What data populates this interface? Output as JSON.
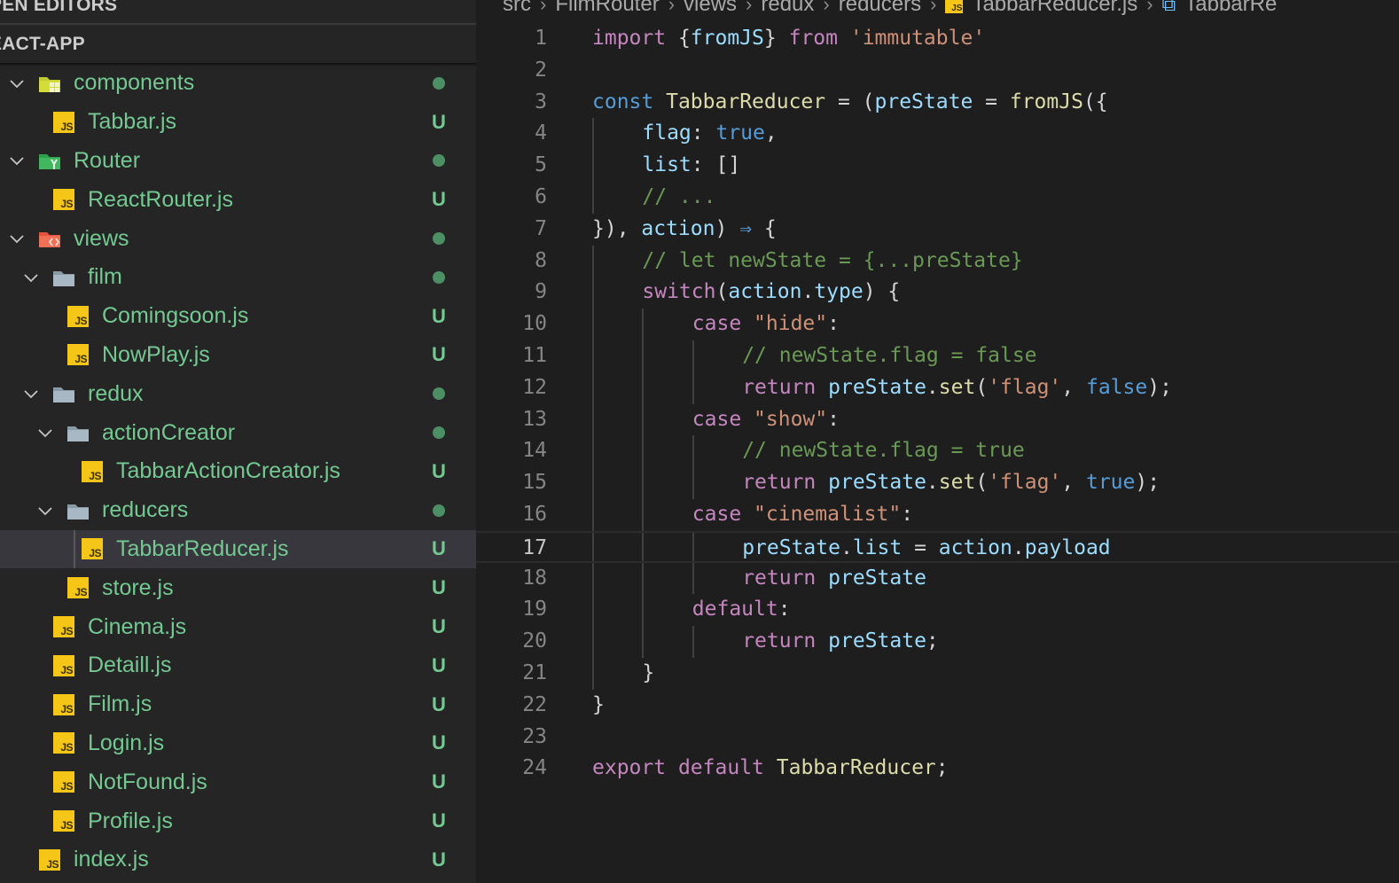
{
  "sidebar": {
    "open_editors_label": "PEN EDITORS",
    "project_label": "EACT-APP",
    "tree": [
      {
        "label": "components",
        "depth": 0,
        "kind": "folder",
        "icon": "components-folder-icon",
        "expanded": true,
        "status": "dot"
      },
      {
        "label": "Tabbar.js",
        "depth": 1,
        "kind": "js",
        "status": "U"
      },
      {
        "label": "Router",
        "depth": 0,
        "kind": "folder",
        "icon": "router-folder-icon",
        "expanded": true,
        "status": "dot"
      },
      {
        "label": "ReactRouter.js",
        "depth": 1,
        "kind": "js",
        "status": "U"
      },
      {
        "label": "views",
        "depth": 0,
        "kind": "folder",
        "icon": "views-folder-icon",
        "expanded": true,
        "status": "dot"
      },
      {
        "label": "film",
        "depth": 1,
        "kind": "folder",
        "icon": "folder-icon",
        "expanded": true,
        "status": "dot"
      },
      {
        "label": "Comingsoon.js",
        "depth": 2,
        "kind": "js",
        "status": "U"
      },
      {
        "label": "NowPlay.js",
        "depth": 2,
        "kind": "js",
        "status": "U"
      },
      {
        "label": "redux",
        "depth": 1,
        "kind": "folder",
        "icon": "folder-icon",
        "expanded": true,
        "status": "dot"
      },
      {
        "label": "actionCreator",
        "depth": 2,
        "kind": "folder",
        "icon": "folder-icon",
        "expanded": true,
        "status": "dot"
      },
      {
        "label": "TabbarActionCreator.js",
        "depth": 3,
        "kind": "js",
        "status": "U"
      },
      {
        "label": "reducers",
        "depth": 2,
        "kind": "folder",
        "icon": "folder-icon",
        "expanded": true,
        "status": "dot"
      },
      {
        "label": "TabbarReducer.js",
        "depth": 3,
        "kind": "js",
        "status": "U",
        "active": true
      },
      {
        "label": "store.js",
        "depth": 2,
        "kind": "js",
        "status": "U"
      },
      {
        "label": "Cinema.js",
        "depth": 1,
        "kind": "js",
        "status": "U"
      },
      {
        "label": "Detaill.js",
        "depth": 1,
        "kind": "js",
        "status": "U"
      },
      {
        "label": "Film.js",
        "depth": 1,
        "kind": "js",
        "status": "U"
      },
      {
        "label": "Login.js",
        "depth": 1,
        "kind": "js",
        "status": "U"
      },
      {
        "label": "NotFound.js",
        "depth": 1,
        "kind": "js",
        "status": "U"
      },
      {
        "label": "Profile.js",
        "depth": 1,
        "kind": "js",
        "status": "U"
      },
      {
        "label": "index.js",
        "depth": 0,
        "kind": "js",
        "status": "U"
      }
    ]
  },
  "breadcrumb": {
    "items": [
      "src",
      "FilmRouter",
      "views",
      "redux",
      "reducers",
      "TabbarReducer.js",
      "TabbarRe"
    ],
    "js_badge": "JS",
    "symbol_icon": "symbol-variable-icon"
  },
  "editor": {
    "active_line": 17,
    "lines": [
      {
        "n": "1",
        "indent": 0,
        "tokens": [
          [
            "kw",
            "import"
          ],
          [
            "pn",
            " {"
          ],
          [
            "vr",
            "fromJS"
          ],
          [
            "pn",
            "} "
          ],
          [
            "kw",
            "from"
          ],
          [
            "pn",
            " "
          ],
          [
            "str",
            "'immutable'"
          ]
        ]
      },
      {
        "n": "2",
        "indent": 0,
        "tokens": []
      },
      {
        "n": "3",
        "indent": 0,
        "tokens": [
          [
            "st",
            "const"
          ],
          [
            "pn",
            " "
          ],
          [
            "fn",
            "TabbarReducer"
          ],
          [
            "pn",
            " = ("
          ],
          [
            "vr",
            "preState"
          ],
          [
            "pn",
            " = "
          ],
          [
            "fn",
            "fromJS"
          ],
          [
            "pn",
            "({"
          ]
        ]
      },
      {
        "n": "4",
        "indent": 1,
        "tokens": [
          [
            "vr",
            "flag"
          ],
          [
            "pn",
            ": "
          ],
          [
            "st",
            "true"
          ],
          [
            "pn",
            ","
          ]
        ]
      },
      {
        "n": "5",
        "indent": 1,
        "tokens": [
          [
            "vr",
            "list"
          ],
          [
            "pn",
            ": []"
          ]
        ]
      },
      {
        "n": "6",
        "indent": 1,
        "tokens": [
          [
            "cm",
            "// ..."
          ]
        ]
      },
      {
        "n": "7",
        "indent": 0,
        "tokens": [
          [
            "pn",
            "}), "
          ],
          [
            "vr",
            "action"
          ],
          [
            "pn",
            ") "
          ],
          [
            "st",
            "⇒"
          ],
          [
            "pn",
            " {"
          ]
        ]
      },
      {
        "n": "8",
        "indent": 1,
        "tokens": [
          [
            "cm",
            "// let newState = {...preState}"
          ]
        ]
      },
      {
        "n": "9",
        "indent": 1,
        "tokens": [
          [
            "kw",
            "switch"
          ],
          [
            "pn",
            "("
          ],
          [
            "vr",
            "action"
          ],
          [
            "pn",
            "."
          ],
          [
            "vr",
            "type"
          ],
          [
            "pn",
            ") {"
          ]
        ]
      },
      {
        "n": "10",
        "indent": 2,
        "tokens": [
          [
            "kw",
            "case"
          ],
          [
            "pn",
            " "
          ],
          [
            "str",
            "\"hide\""
          ],
          [
            "pn",
            ":"
          ]
        ]
      },
      {
        "n": "11",
        "indent": 3,
        "tokens": [
          [
            "cm",
            "// newState.flag = false"
          ]
        ]
      },
      {
        "n": "12",
        "indent": 3,
        "tokens": [
          [
            "kw",
            "return"
          ],
          [
            "pn",
            " "
          ],
          [
            "vr",
            "preState"
          ],
          [
            "pn",
            "."
          ],
          [
            "fn",
            "set"
          ],
          [
            "pn",
            "("
          ],
          [
            "str",
            "'flag'"
          ],
          [
            "pn",
            ", "
          ],
          [
            "st",
            "false"
          ],
          [
            "pn",
            ");"
          ]
        ]
      },
      {
        "n": "13",
        "indent": 2,
        "tokens": [
          [
            "kw",
            "case"
          ],
          [
            "pn",
            " "
          ],
          [
            "str",
            "\"show\""
          ],
          [
            "pn",
            ":"
          ]
        ]
      },
      {
        "n": "14",
        "indent": 3,
        "tokens": [
          [
            "cm",
            "// newState.flag = true"
          ]
        ]
      },
      {
        "n": "15",
        "indent": 3,
        "tokens": [
          [
            "kw",
            "return"
          ],
          [
            "pn",
            " "
          ],
          [
            "vr",
            "preState"
          ],
          [
            "pn",
            "."
          ],
          [
            "fn",
            "set"
          ],
          [
            "pn",
            "("
          ],
          [
            "str",
            "'flag'"
          ],
          [
            "pn",
            ", "
          ],
          [
            "st",
            "true"
          ],
          [
            "pn",
            ");"
          ]
        ]
      },
      {
        "n": "16",
        "indent": 2,
        "tokens": [
          [
            "kw",
            "case"
          ],
          [
            "pn",
            " "
          ],
          [
            "str",
            "\"cinemalist\""
          ],
          [
            "pn",
            ":"
          ]
        ]
      },
      {
        "n": "17",
        "indent": 3,
        "tokens": [
          [
            "vr",
            "preState"
          ],
          [
            "pn",
            "."
          ],
          [
            "vr",
            "list"
          ],
          [
            "pn",
            " = "
          ],
          [
            "vr",
            "action"
          ],
          [
            "pn",
            "."
          ],
          [
            "vr",
            "payload"
          ]
        ]
      },
      {
        "n": "18",
        "indent": 3,
        "tokens": [
          [
            "kw",
            "return"
          ],
          [
            "pn",
            " "
          ],
          [
            "vr",
            "preState"
          ]
        ]
      },
      {
        "n": "19",
        "indent": 2,
        "tokens": [
          [
            "kw",
            "default"
          ],
          [
            "pn",
            ":"
          ]
        ]
      },
      {
        "n": "20",
        "indent": 3,
        "tokens": [
          [
            "kw",
            "return"
          ],
          [
            "pn",
            " "
          ],
          [
            "vr",
            "preState"
          ],
          [
            "pn",
            ";"
          ]
        ]
      },
      {
        "n": "21",
        "indent": 1,
        "tokens": [
          [
            "pn",
            "}"
          ]
        ]
      },
      {
        "n": "22",
        "indent": 0,
        "tokens": [
          [
            "pn",
            "}"
          ]
        ]
      },
      {
        "n": "23",
        "indent": 0,
        "tokens": []
      },
      {
        "n": "24",
        "indent": 0,
        "tokens": [
          [
            "kw",
            "export"
          ],
          [
            "pn",
            " "
          ],
          [
            "kw",
            "default"
          ],
          [
            "pn",
            " "
          ],
          [
            "fn",
            "TabbarReducer"
          ],
          [
            "pn",
            ";"
          ]
        ]
      }
    ]
  }
}
